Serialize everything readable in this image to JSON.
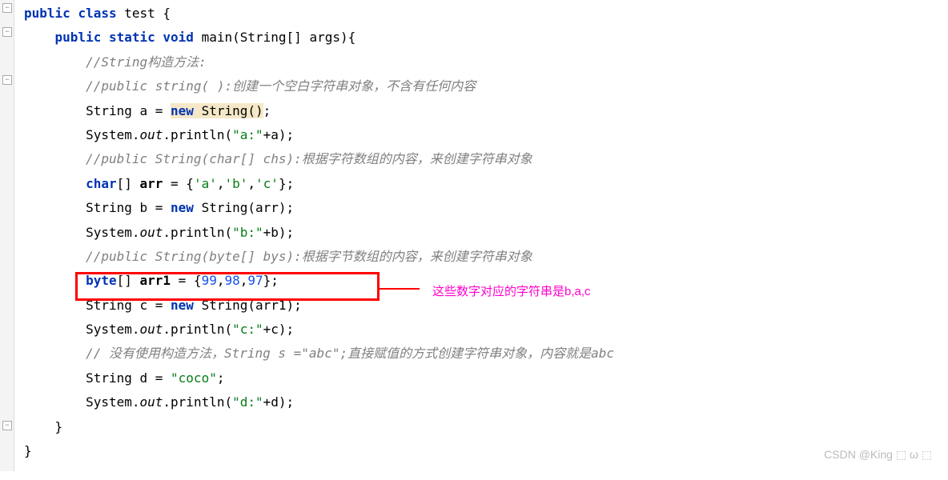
{
  "code": {
    "l1_public": "public",
    "l1_class": "class",
    "l1_name": "test",
    "l1_brace": " {",
    "l2_public": "public",
    "l2_static": "static",
    "l2_void": "void",
    "l2_main": "main",
    "l2_params": "(String[] args){",
    "l3_comment": "//String构造方法:",
    "l4_comment": "//public string( ):创建一个空白字符串对象，不含有任何内容",
    "l5_pre": "String a = ",
    "l5_new": "new",
    "l5_ctor": " String()",
    "l5_semi": ";",
    "l6_sys": "System.",
    "l6_out": "out",
    "l6_println": ".println(",
    "l6_str": "\"a:\"",
    "l6_plus": "+a);",
    "l7_comment": "//public String(char[] chs):根据字符数组的内容，来创建字符串对象",
    "l8_char": "char",
    "l8_arr": "[] ",
    "l8_arrname": "arr",
    "l8_eq": " = {",
    "l8_c1": "'a'",
    "l8_c2": "'b'",
    "l8_c3": "'c'",
    "l8_close": "};",
    "l9_pre": "String b = ",
    "l9_new": "new",
    "l9_ctor": " String(arr);",
    "l10_sys": "System.",
    "l10_out": "out",
    "l10_println": ".println(",
    "l10_str": "\"b:\"",
    "l10_plus": "+b);",
    "l11_comment": "//public String(byte[] bys):根据字节数组的内容，来创建字符串对象",
    "l12_byte": "byte",
    "l12_arr": "[] ",
    "l12_arrname": "arr1",
    "l12_eq": " = {",
    "l12_n1": "99",
    "l12_n2": "98",
    "l12_n3": "97",
    "l12_close": "};",
    "l13_pre": "String c = ",
    "l13_new": "new",
    "l13_ctor": " String(arr1);",
    "l14_sys": "System.",
    "l14_out": "out",
    "l14_println": ".println(",
    "l14_str": "\"c:\"",
    "l14_plus": "+c);",
    "l15_comment": "// 没有使用构造方法，String s =\"abc\";直接赋值的方式创建字符串对象，内容就是abc",
    "l16_pre": "String d = ",
    "l16_str": "\"coco\"",
    "l16_semi": ";",
    "l17_sys": "System.",
    "l17_out": "out",
    "l17_println": ".println(",
    "l17_str": "\"d:\"",
    "l17_plus": "+d);",
    "l18": "}",
    "l19": "}"
  },
  "callout": {
    "text": "这些数字对应的字符串是b,a,c"
  },
  "watermark": "CSDN @King ⬚ ω ⬚"
}
